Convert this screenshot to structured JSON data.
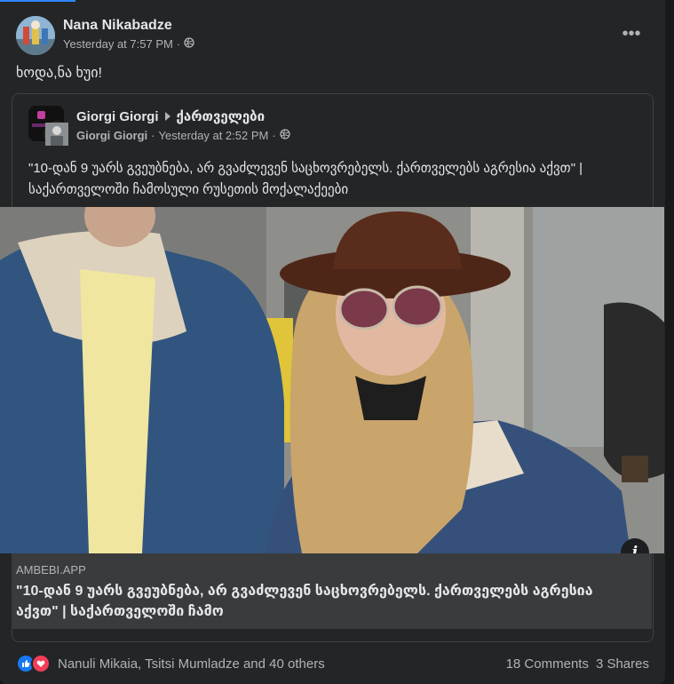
{
  "post": {
    "author": "Nana Nikabadze",
    "time": "Yesterday at 7:57 PM",
    "audience_icon": "globe-icon",
    "more_icon": "more-options-icon",
    "text": "ხოდა,ნა ხუი!"
  },
  "shared": {
    "author": "Giorgi Giorgi",
    "group": "ქართველები",
    "sub_author": "Giorgi Giorgi",
    "time": "Yesterday at 2:52 PM",
    "audience_icon": "globe-icon",
    "text": "\"10-დან 9 უარს გვეუბნება, არ გვაძლევენ საცხოვრებელს. ქართველებს აგრესია აქვთ\" | საქართველოში ჩამოსული რუსეთის მოქალაქეები"
  },
  "link_preview": {
    "domain": "AMBEBI.APP",
    "title": "\"10-დან 9 უარს გვეუბნება, არ გვაძლევენ საცხოვრებელს. ქართველებს აგრესია აქვთ\" | საქართველოში ჩამო",
    "info_label": "i"
  },
  "footer": {
    "reactions_text": "Nanuli Mikaia, Tsitsi Mumladze and 40 others",
    "comments": "18 Comments",
    "shares": "3 Shares"
  },
  "colors": {
    "background": "#18191a",
    "card": "#242526",
    "text_primary": "#e4e6eb",
    "text_secondary": "#b0b3b8",
    "like_blue": "#1877f2",
    "love_red": "#f33e58"
  }
}
